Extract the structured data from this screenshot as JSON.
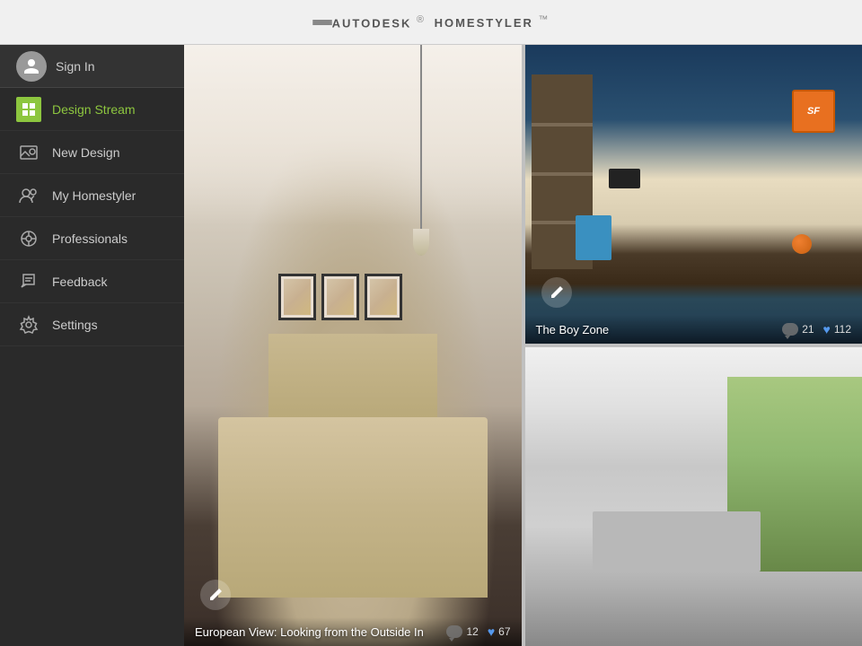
{
  "header": {
    "title_prefix": "AUTODESK",
    "title_super": "®",
    "title_main": "HOMESTYLER",
    "title_trademark": "™",
    "menu_icon_label": "menu"
  },
  "sidebar": {
    "sign_in_label": "Sign In",
    "items": [
      {
        "id": "design-stream",
        "label": "Design Stream",
        "active": true
      },
      {
        "id": "new-design",
        "label": "New Design",
        "active": false
      },
      {
        "id": "my-homestyler",
        "label": "My Homestyler",
        "active": false
      },
      {
        "id": "professionals",
        "label": "Professionals",
        "active": false
      },
      {
        "id": "feedback",
        "label": "Feedback",
        "active": false
      },
      {
        "id": "settings",
        "label": "Settings",
        "active": false
      }
    ]
  },
  "designs": {
    "card1": {
      "title": "European View: Looking from the Outside In",
      "comments": "12",
      "likes": "67",
      "edit_icon": "✎"
    },
    "card2": {
      "title": "The Boy Zone",
      "comments": "21",
      "likes": "112",
      "edit_icon": "✎"
    },
    "card3": {
      "title": "",
      "comments": "",
      "likes": ""
    }
  },
  "icons": {
    "menu": "☰",
    "user": "👤",
    "design_stream": "⊞",
    "new_design": "📷",
    "my_homestyler": "👥",
    "professionals": "⚙",
    "feedback": "✂",
    "settings": "⚙",
    "heart": "♥",
    "chat": "💬",
    "edit": "✎"
  }
}
